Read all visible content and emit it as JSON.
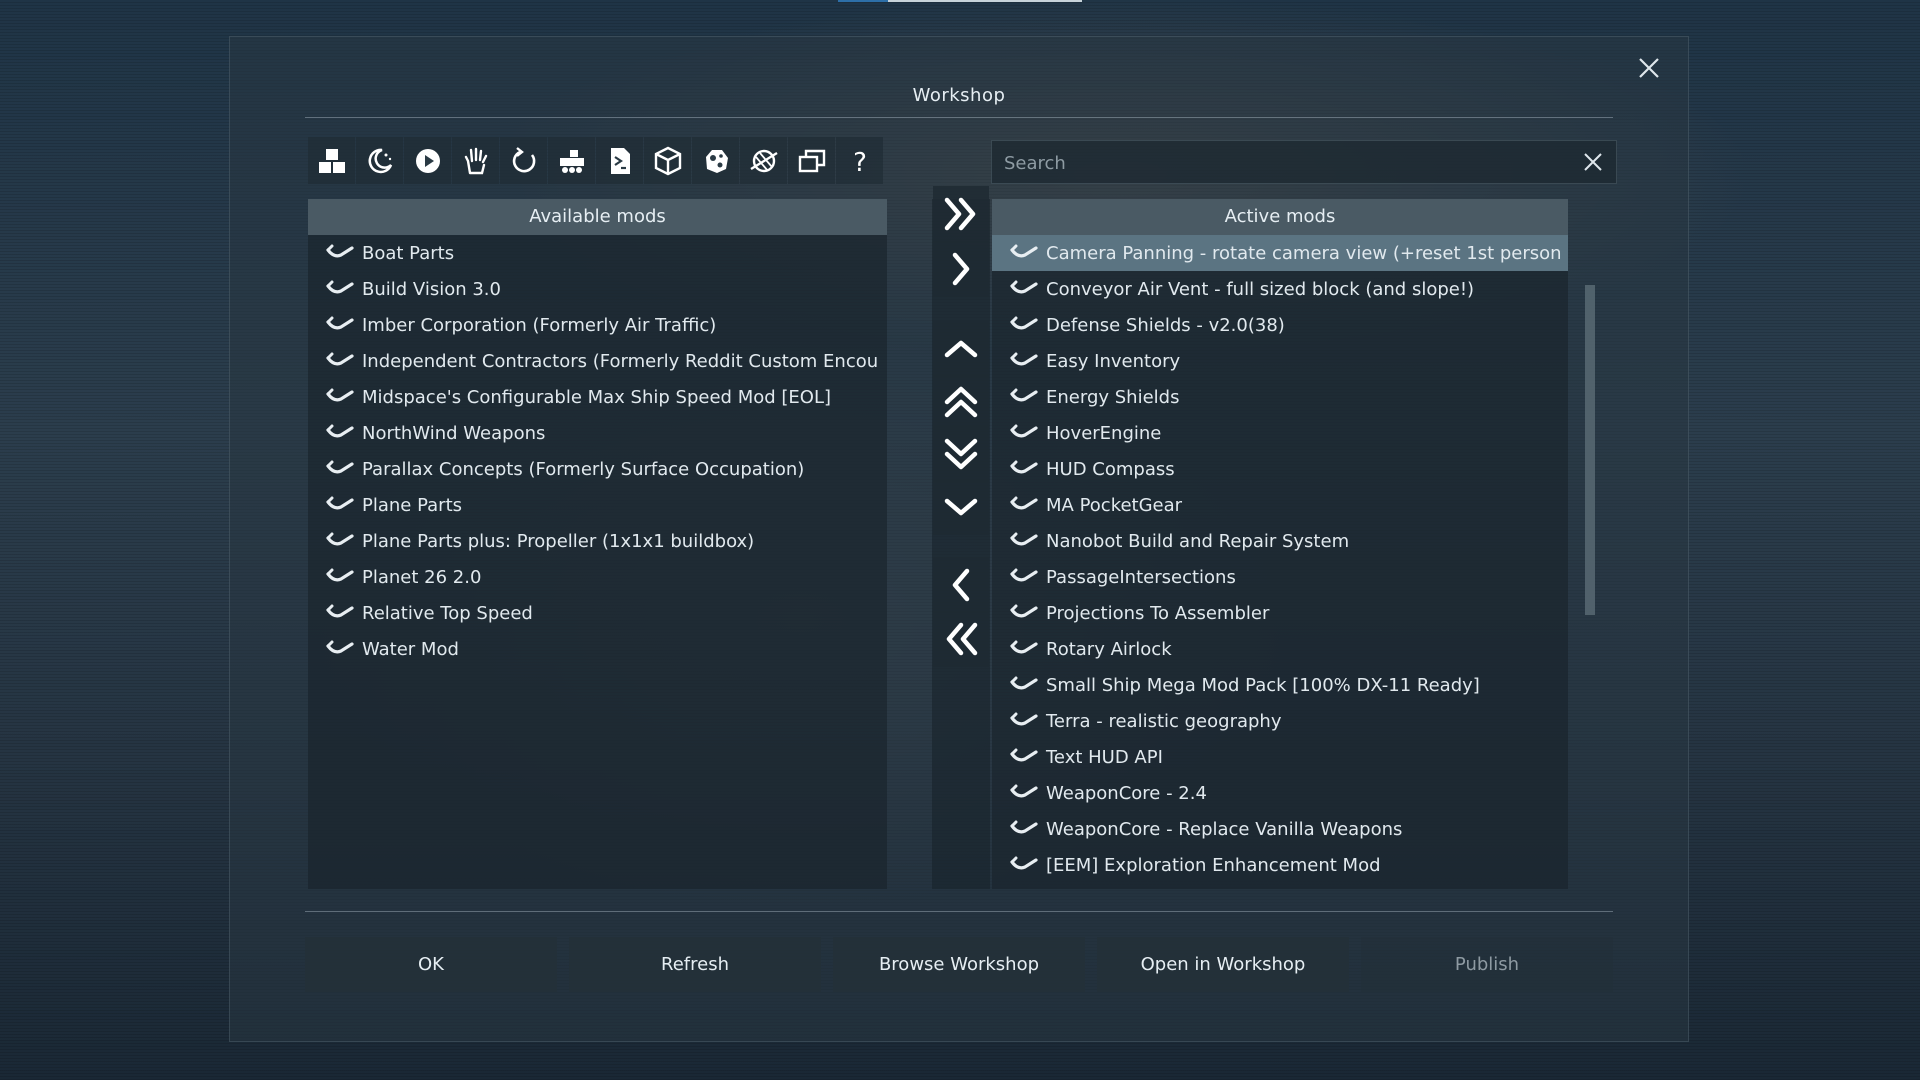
{
  "window": {
    "title": "Workshop"
  },
  "toolbar": {
    "icons": [
      "blocks-icon",
      "night-moon-icon",
      "play-icon",
      "hand-icon",
      "refresh-icon",
      "vehicle-icon",
      "script-file-icon",
      "cube-icon",
      "asteroid-icon",
      "planet-icon",
      "windows-icon",
      "help-icon"
    ],
    "help_glyph": "?"
  },
  "search": {
    "placeholder": "Search",
    "value": ""
  },
  "available": {
    "header": "Available mods",
    "items": [
      "Boat Parts",
      "Build Vision 3.0",
      "Imber Corporation (Formerly Air Traffic)",
      "Independent Contractors (Formerly Reddit Custom Encou",
      "Midspace's Configurable Max Ship Speed Mod [EOL]",
      "NorthWind Weapons",
      "Parallax Concepts (Formerly Surface Occupation)",
      "Plane Parts",
      "Plane Parts plus: Propeller (1x1x1 buildbox)",
      "Planet 26 2.0",
      "Relative Top Speed",
      "Water Mod"
    ]
  },
  "active": {
    "header": "Active mods",
    "selected_index": 0,
    "items": [
      "Camera Panning - rotate camera view (+reset 1st person",
      "Conveyor Air Vent - full sized block (and slope!)",
      "Defense Shields - v2.0(38)",
      "Easy Inventory",
      "Energy Shields",
      "HoverEngine",
      "HUD Compass",
      "MA PocketGear",
      "Nanobot Build and Repair System",
      "PassageIntersections",
      "Projections To Assembler",
      "Rotary Airlock",
      "Small Ship Mega Mod Pack [100% DX-11 Ready]",
      "Terra - realistic geography",
      "Text HUD API",
      "WeaponCore - 2.4",
      "WeaponCore - Replace Vanilla Weapons",
      "[EEM] Exploration Enhancement Mod"
    ]
  },
  "transfer_buttons": [
    "move-all-right-icon",
    "move-right-icon",
    "move-up-icon",
    "move-to-top-icon",
    "move-to-bottom-icon",
    "move-down-icon",
    "move-left-icon",
    "move-all-left-icon"
  ],
  "buttons": {
    "ok": "OK",
    "refresh": "Refresh",
    "browse": "Browse Workshop",
    "open": "Open in Workshop",
    "publish": "Publish"
  },
  "colors": {
    "selected_row": "#5b7482",
    "header_bg": "#4a5a64"
  }
}
